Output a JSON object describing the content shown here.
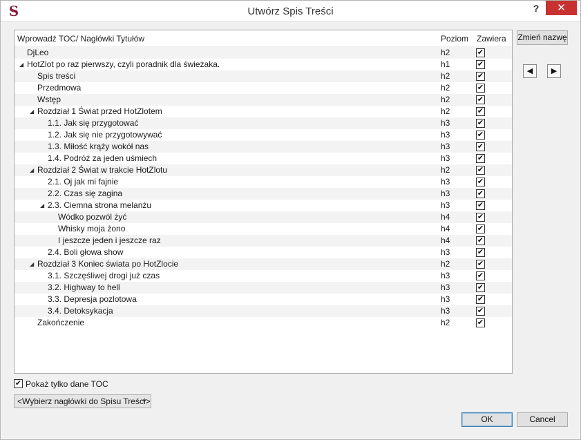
{
  "window": {
    "title": "Utwórz Spis Treści",
    "help_label": "?",
    "close_label": "✕",
    "app_icon_glyph": "S"
  },
  "tree": {
    "columns": [
      "Wprowadź TOC/ Nagłówki Tytułów",
      "Poziom",
      "Zawiera"
    ],
    "rows": [
      {
        "label": "DjLeo",
        "level": "h2",
        "depth": 0,
        "expander": false,
        "checked": true
      },
      {
        "label": "HotZlot po raz pierwszy, czyli poradnik dla świeżaka.",
        "level": "h1",
        "depth": 0,
        "expander": true,
        "checked": true
      },
      {
        "label": "Spis treści",
        "level": "h2",
        "depth": 1,
        "expander": false,
        "checked": true
      },
      {
        "label": "Przedmowa",
        "level": "h2",
        "depth": 1,
        "expander": false,
        "checked": true
      },
      {
        "label": "Wstęp",
        "level": "h2",
        "depth": 1,
        "expander": false,
        "checked": true
      },
      {
        "label": "Rozdział 1 Świat przed HotZlotem",
        "level": "h2",
        "depth": 1,
        "expander": true,
        "checked": true
      },
      {
        "label": "1.1. Jak się przygotować",
        "level": "h3",
        "depth": 2,
        "expander": false,
        "checked": true
      },
      {
        "label": "1.2. Jak się nie przygotowywać",
        "level": "h3",
        "depth": 2,
        "expander": false,
        "checked": true
      },
      {
        "label": "1.3. Miłość krąży wokół nas",
        "level": "h3",
        "depth": 2,
        "expander": false,
        "checked": true
      },
      {
        "label": "1.4. Podróż za jeden uśmiech",
        "level": "h3",
        "depth": 2,
        "expander": false,
        "checked": true
      },
      {
        "label": "Rozdział 2 Świat w trakcie HotZlotu",
        "level": "h2",
        "depth": 1,
        "expander": true,
        "checked": true
      },
      {
        "label": "2.1. Oj jak mi fajnie",
        "level": "h3",
        "depth": 2,
        "expander": false,
        "checked": true
      },
      {
        "label": "2.2. Czas się zagina",
        "level": "h3",
        "depth": 2,
        "expander": false,
        "checked": true
      },
      {
        "label": "2.3. Ciemna strona melanżu",
        "level": "h3",
        "depth": 2,
        "expander": true,
        "checked": true
      },
      {
        "label": "Wódko pozwól żyć",
        "level": "h4",
        "depth": 3,
        "expander": false,
        "checked": true
      },
      {
        "label": "Whisky moja żono",
        "level": "h4",
        "depth": 3,
        "expander": false,
        "checked": true
      },
      {
        "label": "I jeszcze jeden i jeszcze raz",
        "level": "h4",
        "depth": 3,
        "expander": false,
        "checked": true
      },
      {
        "label": "2.4. Boli głowa show",
        "level": "h3",
        "depth": 2,
        "expander": false,
        "checked": true
      },
      {
        "label": "Rozdział 3 Koniec świata po HotZlocie",
        "level": "h2",
        "depth": 1,
        "expander": true,
        "checked": true
      },
      {
        "label": "3.1. Szczęśliwej drogi już czas",
        "level": "h3",
        "depth": 2,
        "expander": false,
        "checked": true
      },
      {
        "label": "3.2. Highway to hell",
        "level": "h3",
        "depth": 2,
        "expander": false,
        "checked": true
      },
      {
        "label": "3.3. Depresja pozlotowa",
        "level": "h3",
        "depth": 2,
        "expander": false,
        "checked": true
      },
      {
        "label": "3.4. Detoksykacja",
        "level": "h3",
        "depth": 2,
        "expander": false,
        "checked": true
      },
      {
        "label": "Zakończenie",
        "level": "h2",
        "depth": 1,
        "expander": false,
        "checked": true
      }
    ]
  },
  "side": {
    "rename_label": "Zmień nazwę",
    "left_arrow": "◀",
    "right_arrow": "▶"
  },
  "options": {
    "show_toc_only_label": "Pokaż tylko dane TOC",
    "show_toc_only_checked": true,
    "heading_select_value": "<Wybierz nagłówki do Spisu Treści>"
  },
  "footer": {
    "ok_label": "OK",
    "cancel_label": "Cancel"
  },
  "icons": {
    "expander": "expanded-triangle-icon",
    "check": "checkmark-icon"
  }
}
